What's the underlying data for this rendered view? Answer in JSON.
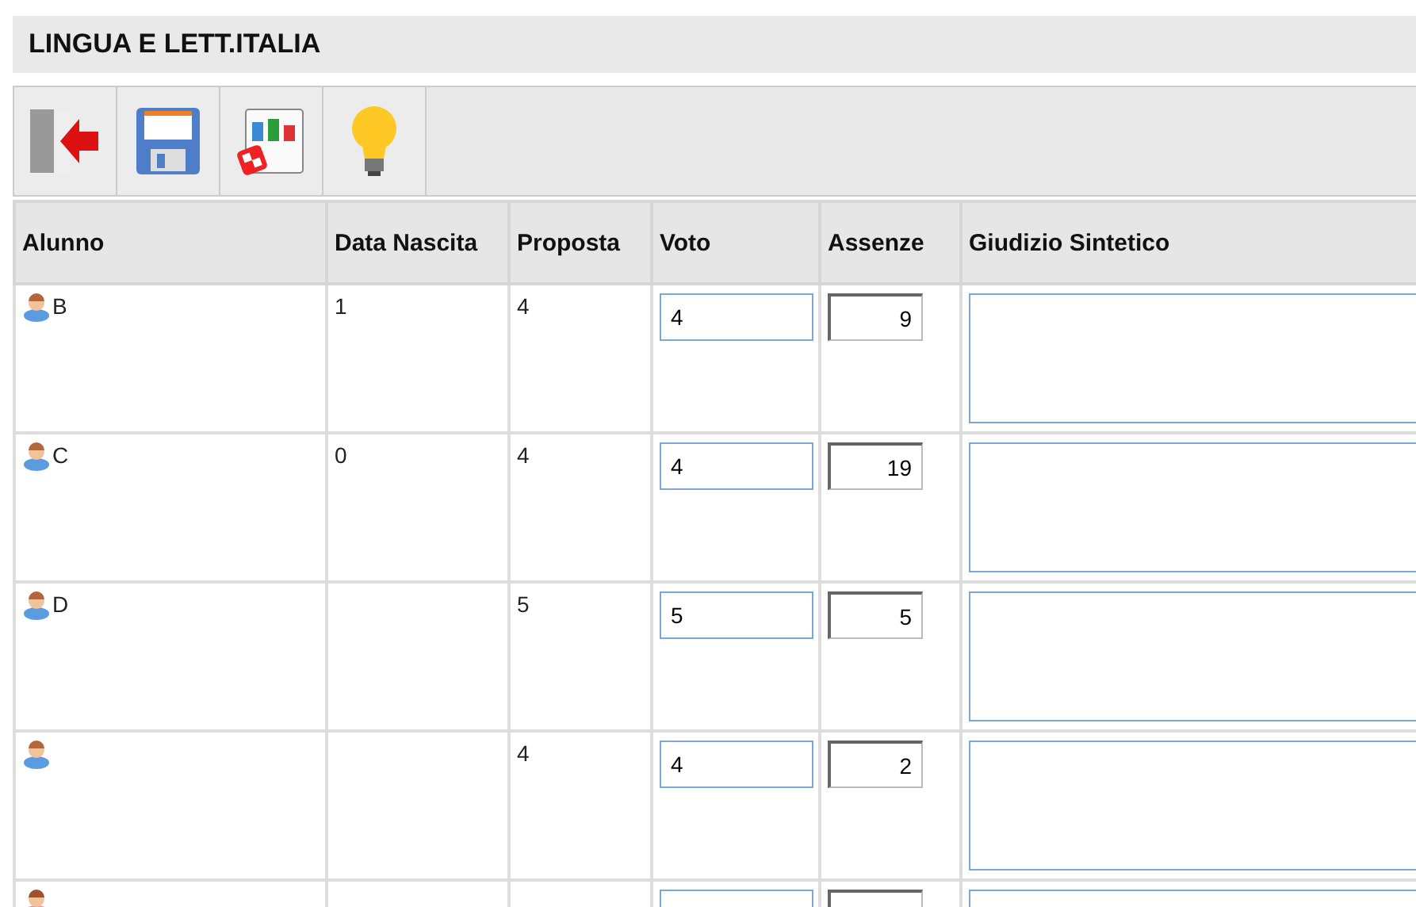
{
  "title": "LINGUA E LETT.ITALIA",
  "toolbar": [
    {
      "kind": "exit"
    },
    {
      "kind": "save"
    },
    {
      "kind": "spell"
    },
    {
      "kind": "hint"
    }
  ],
  "columns": [
    "Alunno",
    "Data Nascita",
    "Proposta",
    "Voto",
    "Assenze",
    "Giudizio Sintetico"
  ],
  "rows": [
    {
      "kind": "male",
      "name": "B",
      "birth": "1",
      "proposta": "4",
      "voto": "4",
      "assenze": "9"
    },
    {
      "kind": "male",
      "name": "C",
      "birth": "0",
      "proposta": "4",
      "voto": "4",
      "assenze": "19"
    },
    {
      "kind": "male",
      "name": "D",
      "proposta": "5",
      "voto": "5",
      "assenze": "5"
    },
    {
      "kind": "male",
      "proposta": "4",
      "voto": "4",
      "assenze": "2"
    },
    {
      "kind": "female"
    }
  ]
}
